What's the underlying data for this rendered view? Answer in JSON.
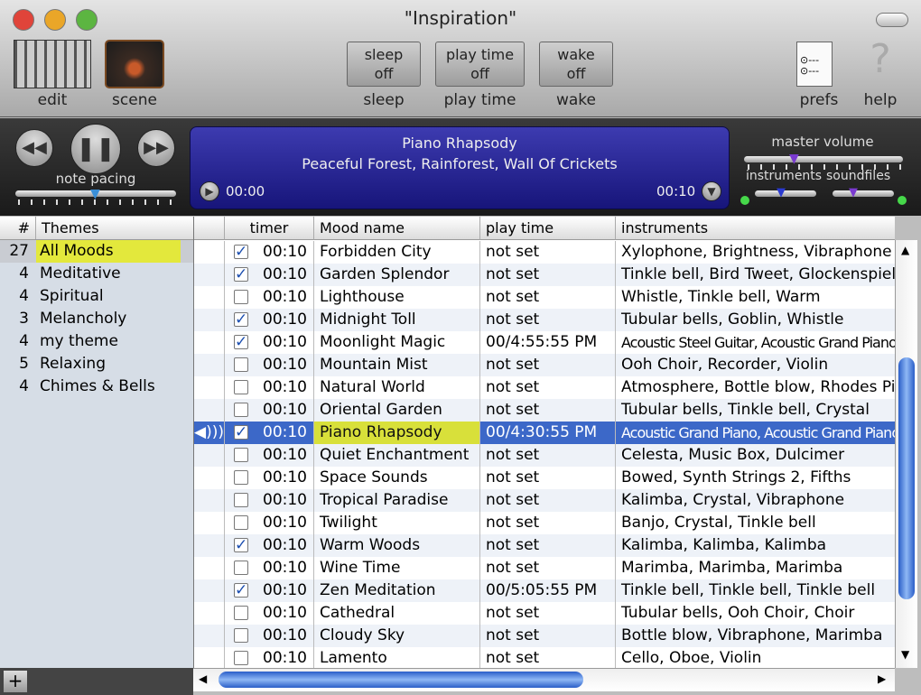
{
  "window": {
    "title": "\"Inspiration\""
  },
  "toolbar": {
    "edit": "edit",
    "scene": "scene",
    "sleep_btn": [
      "sleep",
      "off"
    ],
    "sleep": "sleep",
    "playtime_btn": [
      "play time",
      "off"
    ],
    "playtime": "play time",
    "wake_btn": [
      "wake",
      "off"
    ],
    "wake": "wake",
    "prefs": "prefs",
    "help": "help"
  },
  "player": {
    "note_pacing": "note pacing",
    "track": "Piano Rhapsody",
    "sounds": "Peaceful Forest, Rainforest, Wall Of Crickets",
    "elapsed": "00:00",
    "duration": "00:10",
    "master_volume": "master volume",
    "instruments": "instruments",
    "soundfiles": "soundfiles",
    "note_pacing_level": 0.5,
    "master_volume_level": 0.3,
    "instruments_level": 0.5,
    "soundfiles_level": 0.5
  },
  "themes": {
    "header_num": "#",
    "header": "Themes",
    "items": [
      {
        "count": "27",
        "name": "All Moods",
        "selected": true
      },
      {
        "count": "4",
        "name": "Meditative"
      },
      {
        "count": "4",
        "name": "Spiritual"
      },
      {
        "count": "3",
        "name": "Melancholy"
      },
      {
        "count": "4",
        "name": "my theme"
      },
      {
        "count": "5",
        "name": "Relaxing"
      },
      {
        "count": "4",
        "name": "Chimes & Bells"
      }
    ]
  },
  "table": {
    "columns": [
      "timer",
      "Mood name",
      "play time",
      "instruments"
    ],
    "rows": [
      {
        "on": true,
        "timer": "00:10",
        "name": "Forbidden City",
        "play": "not set",
        "inst": "Xylophone, Brightness, Vibraphone"
      },
      {
        "on": true,
        "timer": "00:10",
        "name": "Garden Splendor",
        "play": "not set",
        "inst": "Tinkle bell, Bird Tweet, Glockenspiel"
      },
      {
        "on": false,
        "timer": "00:10",
        "name": "Lighthouse",
        "play": "not set",
        "inst": "Whistle, Tinkle bell, Warm"
      },
      {
        "on": true,
        "timer": "00:10",
        "name": "Midnight Toll",
        "play": "not set",
        "inst": "Tubular bells, Goblin, Whistle"
      },
      {
        "on": true,
        "timer": "00:10",
        "name": "Moonlight Magic",
        "play": "00/4:55:55 PM",
        "inst": "Acoustic Steel Guitar, Acoustic Grand Piano, I"
      },
      {
        "on": false,
        "timer": "00:10",
        "name": "Mountain Mist",
        "play": "not set",
        "inst": "Ooh Choir, Recorder, Violin"
      },
      {
        "on": false,
        "timer": "00:10",
        "name": "Natural World",
        "play": "not set",
        "inst": "Atmosphere, Bottle blow, Rhodes Pian"
      },
      {
        "on": false,
        "timer": "00:10",
        "name": "Oriental Garden",
        "play": "not set",
        "inst": "Tubular bells, Tinkle bell, Crystal"
      },
      {
        "on": true,
        "timer": "00:10",
        "name": "Piano Rhapsody",
        "play": "00/4:30:55 PM",
        "inst": "Acoustic Grand Piano, Acoustic Grand Piano,",
        "selected": true,
        "playing": true
      },
      {
        "on": false,
        "timer": "00:10",
        "name": "Quiet Enchantment",
        "play": "not set",
        "inst": "Celesta, Music Box, Dulcimer"
      },
      {
        "on": false,
        "timer": "00:10",
        "name": "Space Sounds",
        "play": "not set",
        "inst": "Bowed, Synth Strings 2, Fifths"
      },
      {
        "on": false,
        "timer": "00:10",
        "name": "Tropical Paradise",
        "play": "not set",
        "inst": "Kalimba, Crystal, Vibraphone"
      },
      {
        "on": false,
        "timer": "00:10",
        "name": "Twilight",
        "play": "not set",
        "inst": "Banjo, Crystal, Tinkle bell"
      },
      {
        "on": true,
        "timer": "00:10",
        "name": "Warm Woods",
        "play": "not set",
        "inst": "Kalimba, Kalimba, Kalimba"
      },
      {
        "on": false,
        "timer": "00:10",
        "name": "Wine Time",
        "play": "not set",
        "inst": "Marimba, Marimba, Marimba"
      },
      {
        "on": true,
        "timer": "00:10",
        "name": "Zen Meditation",
        "play": "00/5:05:55 PM",
        "inst": "Tinkle bell, Tinkle bell, Tinkle bell"
      },
      {
        "on": false,
        "timer": "00:10",
        "name": "Cathedral",
        "play": "not set",
        "inst": "Tubular bells, Ooh Choir, Choir"
      },
      {
        "on": false,
        "timer": "00:10",
        "name": "Cloudy Sky",
        "play": "not set",
        "inst": "Bottle blow, Vibraphone, Marimba"
      },
      {
        "on": false,
        "timer": "00:10",
        "name": "Lamento",
        "play": "not set",
        "inst": "Cello, Oboe, Violin"
      }
    ]
  },
  "footer": {
    "add": "+"
  }
}
